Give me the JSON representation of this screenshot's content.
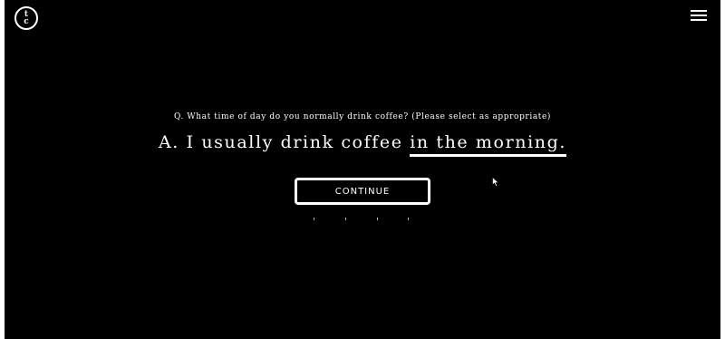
{
  "logo": {
    "top": "t",
    "bottom": "c"
  },
  "question": "Q. What time of day do you normally drink coffee? (Please select as appropriate)",
  "answer": {
    "prefix": "A. I usually drink coffee ",
    "choice": "in the morning."
  },
  "continue_label": "CONTINUE",
  "progress": {
    "total_steps": 4
  },
  "colors": {
    "background": "#000000",
    "foreground": "#ffffff"
  },
  "icons": {
    "menu": "hamburger-menu-icon",
    "logo": "tc-logo"
  }
}
